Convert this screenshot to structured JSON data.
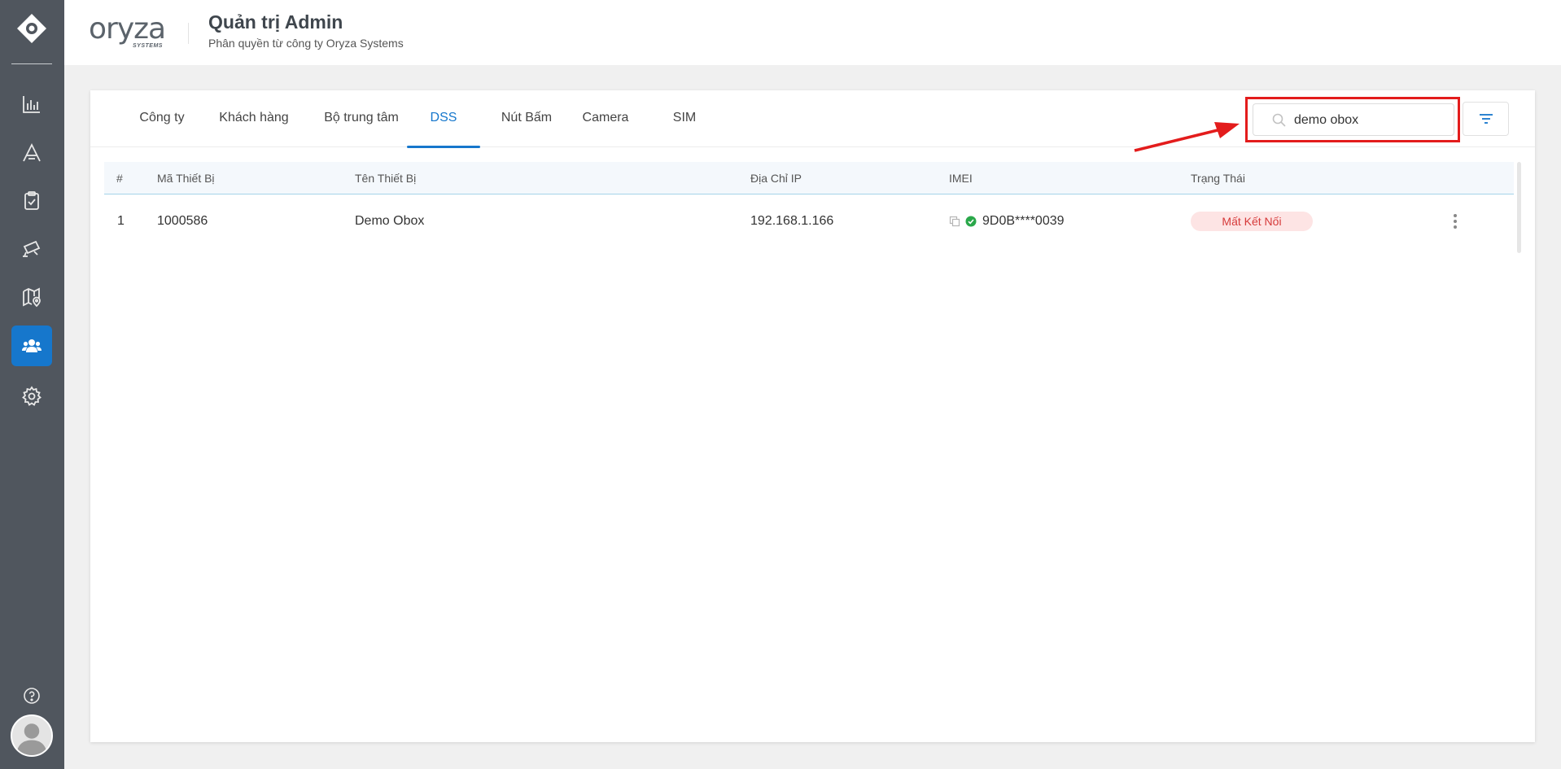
{
  "app": {
    "brand_name": "oryza",
    "brand_sub": "SYSTEMS",
    "title": "Quản trị Admin",
    "subtitle": "Phân quyền từ công ty Oryza Systems"
  },
  "sidebar": {
    "items": [
      {
        "name": "dashboard",
        "icon": "bar-chart-icon"
      },
      {
        "name": "font",
        "icon": "font-a-icon"
      },
      {
        "name": "tasks",
        "icon": "clipboard-check-icon"
      },
      {
        "name": "camera",
        "icon": "cctv-camera-icon"
      },
      {
        "name": "map",
        "icon": "map-pin-icon"
      },
      {
        "name": "users",
        "icon": "users-group-icon",
        "active": true
      },
      {
        "name": "settings",
        "icon": "gear-icon"
      }
    ],
    "help_icon": "question-circle-icon",
    "avatar_icon": "user-avatar-icon",
    "active_color": "#1677cc"
  },
  "tabs": [
    {
      "label": "Công ty"
    },
    {
      "label": "Khách hàng"
    },
    {
      "label": "Bộ trung tâm"
    },
    {
      "label": "DSS",
      "active": true
    },
    {
      "label": "Nút Bấm"
    },
    {
      "label": "Camera"
    },
    {
      "label": "SIM"
    }
  ],
  "search": {
    "value": "demo obox",
    "icon": "search-icon"
  },
  "filter": {
    "icon": "filter-lines-icon"
  },
  "table": {
    "headers": [
      "#",
      "Mã Thiết Bị",
      "Tên Thiết Bị",
      "Địa Chỉ IP",
      "IMEI",
      "Trạng Thái"
    ],
    "rows": [
      {
        "index": "1",
        "device_code": "1000586",
        "device_name": "Demo Obox",
        "ip": "192.168.1.166",
        "imei": "9D0B****0039",
        "status": "Mất Kết Nối"
      }
    ]
  },
  "colors": {
    "accent": "#1677cc",
    "status_offline_bg": "#fde4e4",
    "status_offline_text": "#d63a3a",
    "verified_green": "#2aa84a",
    "annotation_red": "#e31c1c"
  }
}
